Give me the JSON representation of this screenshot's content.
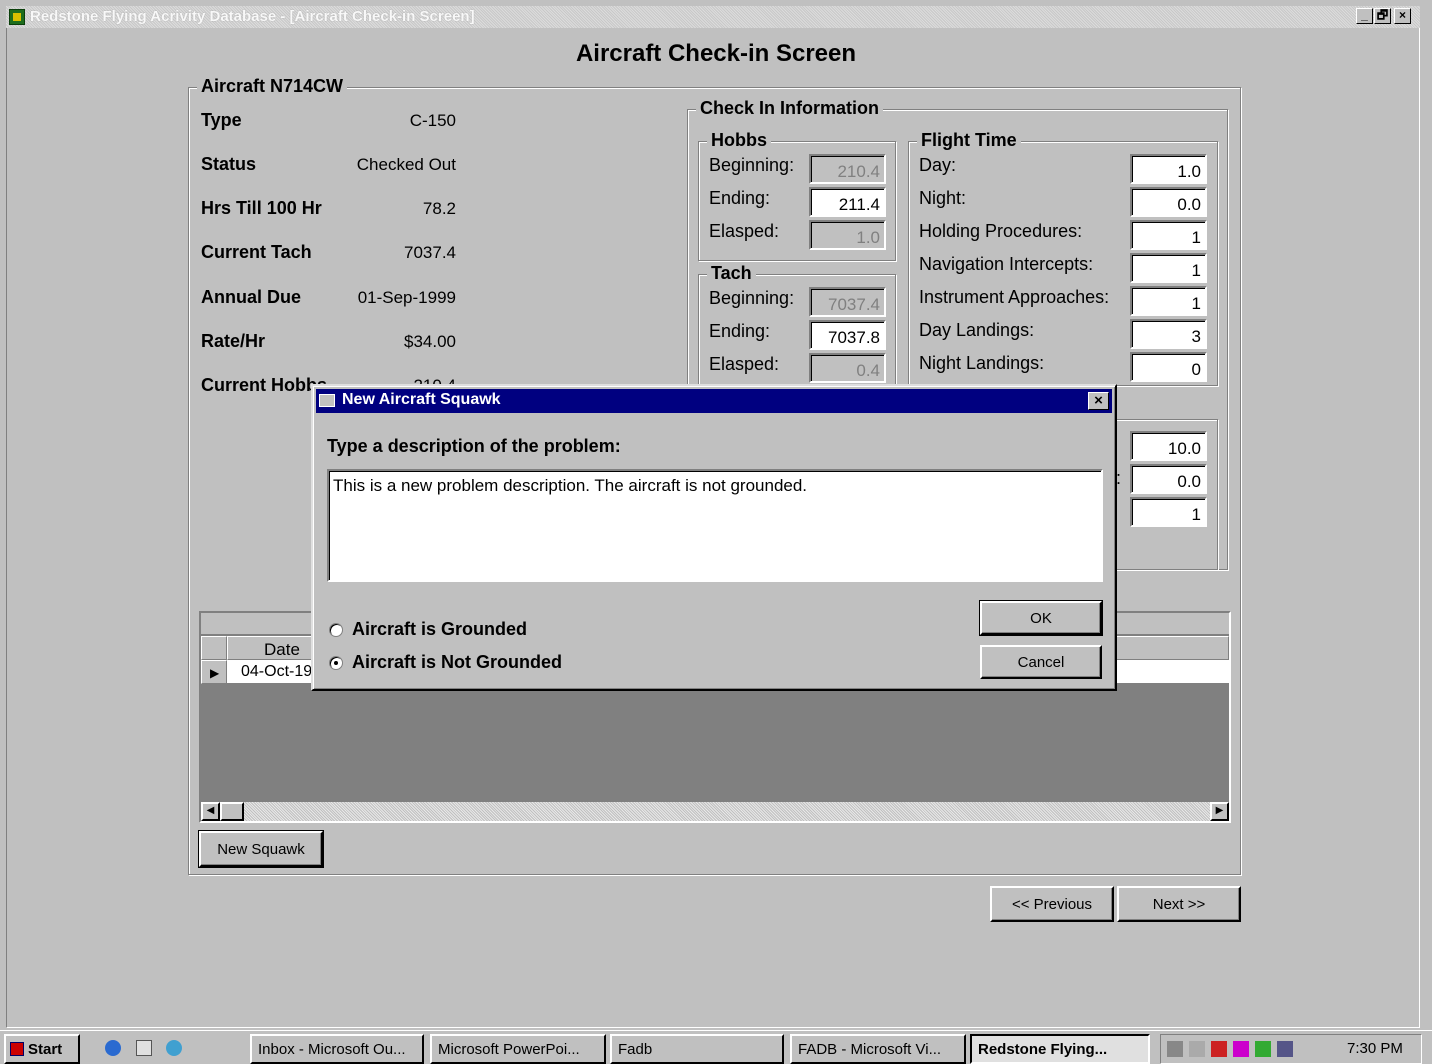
{
  "window": {
    "title": "Redstone Flying Acrivity Database - [Aircraft Check-in Screen]",
    "buttons": [
      "_",
      "🗗",
      "×"
    ]
  },
  "screen_title": "Aircraft Check-in Screen",
  "aircraft": {
    "group_label": "Aircraft N714CW",
    "rows": [
      {
        "label": "Type",
        "value": "C-150"
      },
      {
        "label": "Status",
        "value": "Checked Out"
      },
      {
        "label": "Hrs Till 100 Hr",
        "value": "78.2"
      },
      {
        "label": "Current Tach",
        "value": "7037.4"
      },
      {
        "label": "Annual Due",
        "value": "01-Sep-1999"
      },
      {
        "label": "Rate/Hr",
        "value": "$34.00"
      },
      {
        "label": "Current Hobbs",
        "value": "210.4"
      }
    ]
  },
  "checkin": {
    "group_label": "Check In Information",
    "hobbs": {
      "label": "Hobbs",
      "beginning_label": "Beginning:",
      "beginning": "210.4",
      "ending_label": "Ending:",
      "ending": "211.4",
      "elapsed_label": "Elasped:",
      "elapsed": "1.0"
    },
    "tach": {
      "label": "Tach",
      "beginning_label": "Beginning:",
      "beginning": "7037.4",
      "ending_label": "Ending:",
      "ending": "7037.8",
      "elapsed_label": "Elasped:",
      "elapsed": "0.4"
    },
    "flight_time": {
      "label": "Flight Time",
      "rows": [
        {
          "label": "Day:",
          "value": "1.0"
        },
        {
          "label": "Night:",
          "value": "0.0"
        },
        {
          "label": "Holding Procedures:",
          "value": "1"
        },
        {
          "label": "Navigation Intercepts:",
          "value": "1"
        },
        {
          "label": "Instrument Approaches:",
          "value": "1"
        },
        {
          "label": "Day Landings:",
          "value": "3"
        },
        {
          "label": "Night Landings:",
          "value": "0"
        }
      ]
    },
    "other": {
      "partial_label": "):",
      "values": [
        "10.0",
        "0.0",
        "1"
      ]
    }
  },
  "squawks": {
    "column_date": "Date",
    "rows": [
      {
        "date": "04-Oct-1999"
      }
    ],
    "new_button": "New Squawk"
  },
  "nav": {
    "previous": "<< Previous",
    "next": "Next >>"
  },
  "dialog": {
    "title": "New Aircraft Squawk",
    "prompt": "Type a description of the problem:",
    "description": "This is a new problem description. The aircraft is not grounded.",
    "radio_grounded": "Aircraft is Grounded",
    "radio_not_grounded": "Aircraft is Not Grounded",
    "selected": "not_grounded",
    "ok": "OK",
    "cancel": "Cancel"
  },
  "taskbar": {
    "start": "Start",
    "items": [
      {
        "label": "Inbox - Microsoft Ou..."
      },
      {
        "label": "Microsoft PowerPoi..."
      },
      {
        "label": "Fadb"
      },
      {
        "label": "FADB - Microsoft Vi..."
      },
      {
        "label": "Redstone Flying..."
      }
    ],
    "clock": "7:30 PM"
  }
}
